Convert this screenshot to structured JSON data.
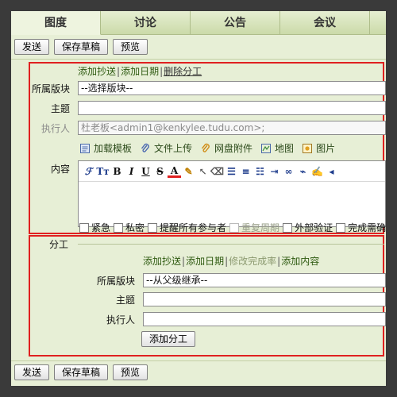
{
  "tabs": [
    {
      "label": "图度",
      "active": true
    },
    {
      "label": "讨论",
      "active": false
    },
    {
      "label": "公告",
      "active": false
    },
    {
      "label": "会议",
      "active": false
    }
  ],
  "toolbar": {
    "send": "发送",
    "save_draft": "保存草稿",
    "preview": "预览"
  },
  "main": {
    "links": [
      {
        "label": "添加抄送",
        "current": false
      },
      {
        "label": "添加日期",
        "current": false
      },
      {
        "label": "删除分工",
        "current": true
      }
    ],
    "board_label": "所属版块",
    "board_value": "--选择版块--",
    "subject_label": "主题",
    "subject_value": "",
    "assignee_label": "执行人",
    "assignee_value": "杜老板<admin1@kenkylee.tudu.com>;",
    "attachments": [
      {
        "label": "加载模板",
        "icon": "template-icon"
      },
      {
        "label": "文件上传",
        "icon": "paperclip-icon"
      },
      {
        "label": "网盘附件",
        "icon": "netdisk-clip-icon"
      },
      {
        "label": "地图",
        "icon": "map-icon"
      },
      {
        "label": "图片",
        "icon": "picture-icon"
      }
    ],
    "content_label": "内容",
    "options": [
      {
        "label": "紧急",
        "disabled": false
      },
      {
        "label": "私密",
        "disabled": false
      },
      {
        "label": "提醒所有参与者",
        "disabled": false
      },
      {
        "label": "重复周期",
        "disabled": true
      },
      {
        "label": "外部验证",
        "disabled": false
      },
      {
        "label": "完成需确",
        "disabled": false
      }
    ]
  },
  "division": {
    "legend": "分工",
    "links": [
      {
        "label": "添加抄送",
        "muted": false
      },
      {
        "label": "添加日期",
        "muted": false
      },
      {
        "label": "修改完成率",
        "muted": true
      },
      {
        "label": "添加内容",
        "muted": false
      }
    ],
    "board_label": "所属版块",
    "board_value": "--从父级继承--",
    "subject_label": "主题",
    "assignee_label": "执行人",
    "add_button": "添加分工"
  },
  "colors": {
    "highlight": "#e02020",
    "panel": "#e7efd6",
    "tab": "#cbdaa9"
  }
}
